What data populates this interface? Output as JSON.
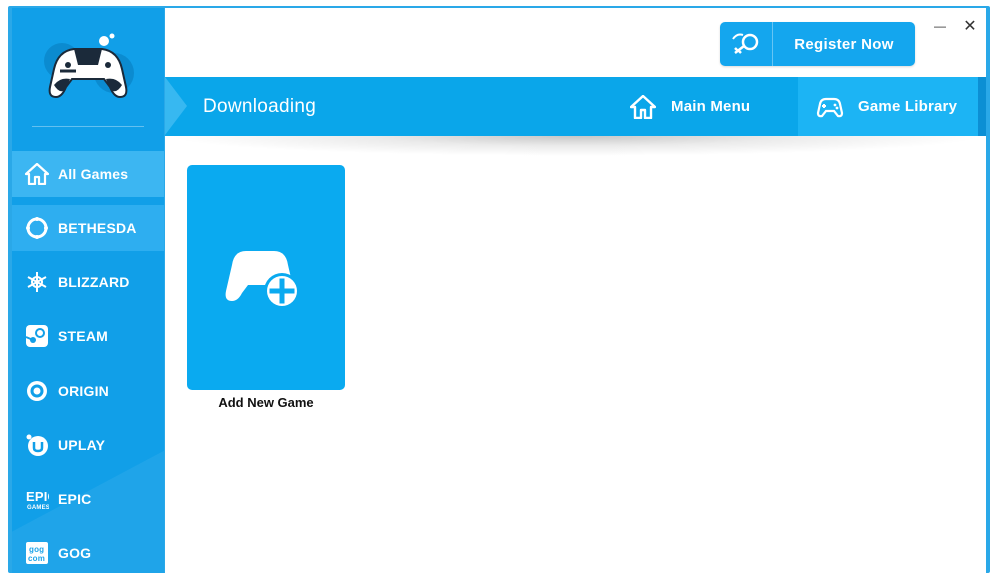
{
  "header": {
    "register_label": "Register Now",
    "minimize_label": "—",
    "close_label": "✕"
  },
  "navbar": {
    "title": "Downloading",
    "tabs": [
      {
        "label": "Main Menu",
        "icon": "home-icon"
      },
      {
        "label": "Game Library",
        "icon": "gamepad-icon"
      }
    ]
  },
  "sidebar": {
    "items": [
      {
        "label": "All Games",
        "icon": "home-icon"
      },
      {
        "label": "BETHESDA",
        "icon": "bethesda-icon"
      },
      {
        "label": "BLIZZARD",
        "icon": "blizzard-icon"
      },
      {
        "label": "STEAM",
        "icon": "steam-icon"
      },
      {
        "label": "ORIGIN",
        "icon": "origin-icon"
      },
      {
        "label": "UPLAY",
        "icon": "uplay-icon"
      },
      {
        "label": "EPIC",
        "icon": "epic-icon"
      },
      {
        "label": "GOG",
        "icon": "gog-icon"
      }
    ]
  },
  "library": {
    "add_card_label": "Add New Game"
  },
  "colors": {
    "sidebar": "#119fe8",
    "accent": "#0aa6ea",
    "card": "#0aaaf0"
  }
}
